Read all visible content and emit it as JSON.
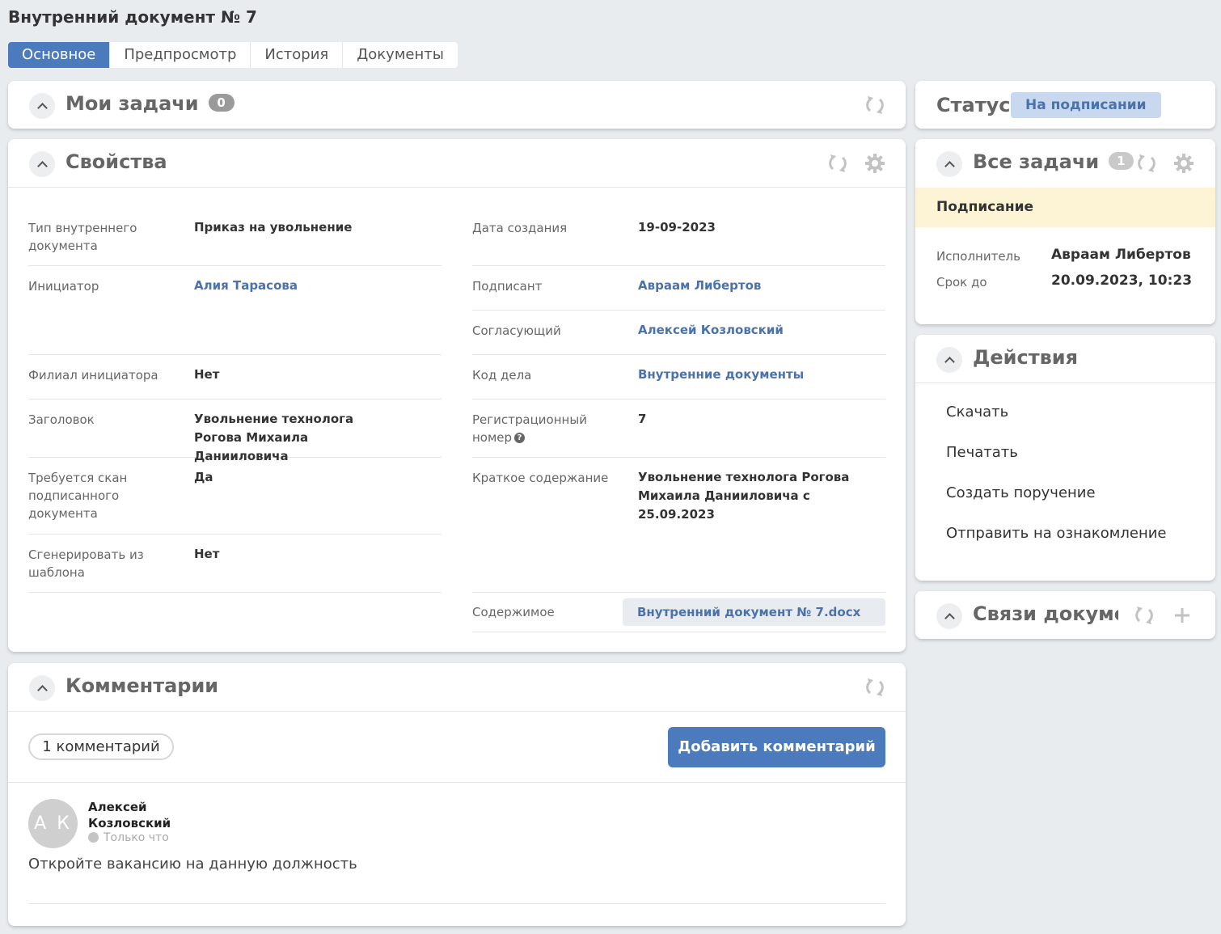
{
  "page": {
    "title": "Внутренний документ № 7"
  },
  "tabs": [
    {
      "label": "Основное"
    },
    {
      "label": "Предпросмотр"
    },
    {
      "label": "История"
    },
    {
      "label": "Документы"
    }
  ],
  "my_tasks": {
    "title": "Мои задачи",
    "count": "0"
  },
  "properties": {
    "title": "Свойства",
    "left": [
      {
        "label": "Тип внутреннего документа",
        "value": "Приказ на увольнение"
      },
      {
        "label": "Инициатор",
        "value": "Алия Тарасова"
      },
      {
        "label": "Филиал инициатора",
        "value": "Нет"
      },
      {
        "label": "Заголовок",
        "value": "Увольнение технолога Рогова Михаила Данииловича"
      },
      {
        "label": "Требуется скан подписанного документа",
        "value": "Да"
      },
      {
        "label": "Сгенерировать из шаблона",
        "value": "Нет"
      }
    ],
    "right": [
      {
        "label": "Дата создания",
        "value": "19-09-2023"
      },
      {
        "label": "Подписант",
        "value": "Авраам Либертов"
      },
      {
        "label": "Согласующий",
        "value": "Алексей Козловский"
      },
      {
        "label": "Код дела",
        "value": "Внутренние документы"
      },
      {
        "label": "Регистрационный номер",
        "value": "7"
      },
      {
        "label": "Краткое содержание",
        "value": "Увольнение технолога Рогова Михаила Данииловича с 25.09.2023"
      },
      {
        "label": "Содержимое",
        "value": "Внутренний документ № 7.docx"
      }
    ]
  },
  "comments": {
    "title": "Комментарии",
    "count_label": "1 комментарий",
    "add_button": "Добавить комментарий",
    "items": [
      {
        "initials": "А К",
        "author": "Алексей Козловский",
        "time": "Только что",
        "text": "Откройте вакансию на данную должность"
      }
    ]
  },
  "status": {
    "label": "Статус",
    "value": "На подписании"
  },
  "all_tasks": {
    "title": "Все задачи",
    "count": "1",
    "task_name": "Подписание",
    "executor_label": "Исполнитель",
    "executor": "Авраам Либертов",
    "due_label": "Срок до",
    "due": "20.09.2023, 10:23"
  },
  "actions": {
    "title": "Действия",
    "items": [
      "Скачать",
      "Печатать",
      "Создать поручение",
      "Отправить на ознакомление"
    ]
  },
  "links": {
    "title": "Связи докумен"
  },
  "colors": {
    "accent": "#4b7bbd",
    "link": "#4b72aa",
    "status_bg": "#c8d8ef",
    "task_bg": "#fdf4d5"
  }
}
